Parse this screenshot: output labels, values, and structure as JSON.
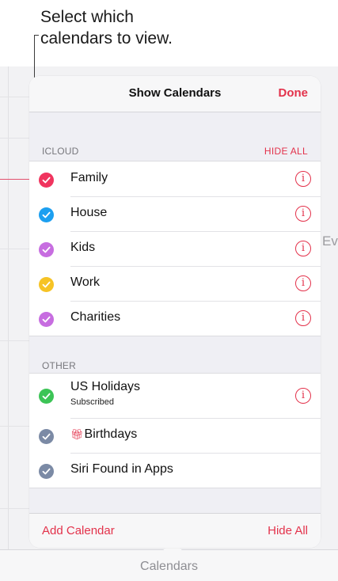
{
  "callout": {
    "line1": "Select which",
    "line2": "calendars to view."
  },
  "background": {
    "peek_text": "Ev",
    "toolbar_label": "Calendars"
  },
  "popover": {
    "title": "Show Calendars",
    "done_label": "Done",
    "sections": [
      {
        "title": "ICLOUD",
        "action": "HIDE ALL",
        "items": [
          {
            "label": "Family",
            "color": "#f0345e",
            "checked": true,
            "info_icon": "info-circle-icon"
          },
          {
            "label": "House",
            "color": "#1c9ff0",
            "checked": true,
            "info_icon": "info-circle-icon"
          },
          {
            "label": "Kids",
            "color": "#c76de0",
            "checked": true,
            "info_icon": "info-circle-icon"
          },
          {
            "label": "Work",
            "color": "#f6c325",
            "checked": true,
            "info_icon": "info-circle-icon"
          },
          {
            "label": "Charities",
            "color": "#c76de0",
            "checked": true,
            "info_icon": "info-circle-icon"
          }
        ]
      },
      {
        "title": "OTHER",
        "items": [
          {
            "label": "US Holidays",
            "subtitle": "Subscribed",
            "color": "#3cc456",
            "checked": true,
            "info_icon": "info-circle-icon"
          },
          {
            "label": "Birthdays",
            "prefix_icon": "gift-icon",
            "prefix_glyph": "🎁︎",
            "color": "#7b8aa5",
            "checked": true
          },
          {
            "label": "Siri Found in Apps",
            "color": "#7b8aa5",
            "checked": true
          }
        ]
      }
    ],
    "info_glyph": "i",
    "footer": {
      "add_label": "Add Calendar",
      "hide_label": "Hide All"
    }
  },
  "colors": {
    "accent": "#e3324b"
  }
}
